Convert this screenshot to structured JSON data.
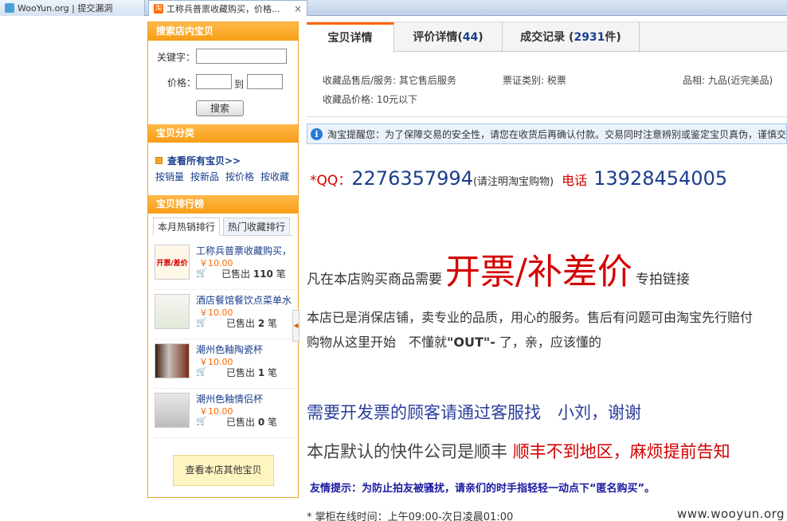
{
  "browser": {
    "tabs": [
      {
        "title": "WooYun.org | 提交漏洞"
      },
      {
        "title": "工称兵普票收藏购买，价格...",
        "favicon_text": "淘"
      }
    ],
    "close_glyph": "×"
  },
  "sidebar": {
    "search": {
      "heading": "搜索店内宝贝",
      "keyword_label": "关键字：",
      "keyword_value": "",
      "price_label": "价格：",
      "price_from": "",
      "price_to_label": "到",
      "price_to": "",
      "button": "搜索"
    },
    "categories": {
      "heading": "宝贝分类",
      "all_link": "查看所有宝贝>>",
      "sort_links": [
        "按销量",
        "按新品",
        "按价格",
        "按收藏"
      ]
    },
    "ranking": {
      "heading": "宝贝排行榜",
      "tabs": [
        "本月热销排行",
        "热门收藏排行"
      ],
      "items": [
        {
          "name": "工称兵普票收藏购买，",
          "price": "￥10.00",
          "sold_prefix": "已售出",
          "sold_count": "110",
          "sold_unit": "笔",
          "thumb_text": "开票/差价"
        },
        {
          "name": "酒店餐馆餐饮点菜单水",
          "price": "￥10.00",
          "sold_prefix": "已售出",
          "sold_count": "2",
          "sold_unit": "笔"
        },
        {
          "name": "潮州色釉陶瓷杯",
          "price": "￥10.00",
          "sold_prefix": "已售出",
          "sold_count": "1",
          "sold_unit": "笔"
        },
        {
          "name": "潮州色釉情侣杯",
          "price": "￥10.00",
          "sold_prefix": "已售出",
          "sold_count": "0",
          "sold_unit": "笔"
        }
      ],
      "more_button": "查看本店其他宝贝"
    }
  },
  "detail": {
    "tabs": [
      {
        "label": "宝贝详情",
        "count": ""
      },
      {
        "label": "评价详情",
        "count": "44"
      },
      {
        "label": "成交记录",
        "count": "2931",
        "unit": "件"
      }
    ],
    "attributes": {
      "after_sale": "收藏品售后/服务: 其它售后服务",
      "ticket_type": "票证类别: 税票",
      "condition": "品相: 九品(近完美品)",
      "price_range": "收藏品价格: 10元以下"
    },
    "notice": "淘宝提醒您：为了保障交易的安全性，请您在收货后再确认付款。交易同时注意辨别或鉴定宝贝真伪，谨慎交易",
    "contact": {
      "qq_label": "*QQ：",
      "qq_number": "2276357994",
      "qq_note": "(请注明淘宝购物)",
      "phone_label": "电话",
      "phone_number": "13928454005"
    },
    "invoice": {
      "prefix": "凡在本店购买商品需要",
      "big": "开票/补差价",
      "suffix": "专拍链接"
    },
    "paragraph_1": "本店已是消保店铺，卖专业的品质，用心的服务。售后有问题可由淘宝先行赔付",
    "paragraph_2_a": "购物从这里开始　不懂就",
    "paragraph_2_b": "\"OUT\"-",
    "paragraph_2_c": " 了，亲，应该懂的",
    "invoice_contact": "需要开发票的顾客请通过客服找　小刘，谢谢",
    "shipping": {
      "text": "本店默认的快件公司是顺丰 ",
      "red": "顺丰不到地区，麻烦提前告知"
    },
    "friendly_tip": "友情提示：为防止拍友被骚扰，请亲们的时手指轻轻一动点下“匿名购买”。",
    "hours": "* 掌柜在线时间：上午09:00-次日凌晨01:00"
  },
  "watermark": "www.wooyun.org"
}
